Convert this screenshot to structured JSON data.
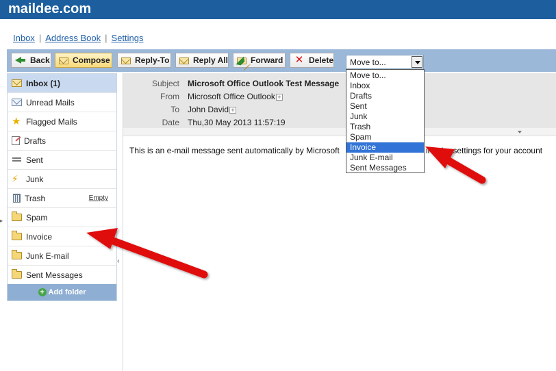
{
  "brand": "maildee.com",
  "nav": {
    "inbox": "Inbox",
    "address_book": "Address Book",
    "settings": "Settings",
    "separator": "|"
  },
  "toolbar": {
    "back": "Back",
    "compose": "Compose",
    "reply_to": "Reply-To",
    "reply_all": "Reply All",
    "forward": "Forward",
    "delete": "Delete"
  },
  "move_to": {
    "selected": "Move to...",
    "options": [
      "Move to...",
      "Inbox",
      "Drafts",
      "Sent",
      "Junk",
      "Trash",
      "Spam",
      "Invoice",
      "Junk E-mail",
      "Sent Messages"
    ],
    "highlighted": "Invoice"
  },
  "folders": [
    {
      "label": "Inbox (1)",
      "icon": "mail-open-icon"
    },
    {
      "label": "Unread Mails",
      "icon": "mail-icon"
    },
    {
      "label": "Flagged Mails",
      "icon": "star-icon"
    },
    {
      "label": "Drafts",
      "icon": "draft-icon"
    },
    {
      "label": "Sent",
      "icon": "sent-icon"
    },
    {
      "label": "Junk",
      "icon": "lightning-icon"
    },
    {
      "label": "Trash",
      "icon": "trash-icon",
      "action": "Empty"
    },
    {
      "label": "Spam",
      "icon": "folder-icon"
    },
    {
      "label": "Invoice",
      "icon": "folder-icon"
    },
    {
      "label": "Junk E-mail",
      "icon": "folder-icon"
    },
    {
      "label": "Sent Messages",
      "icon": "folder-icon"
    }
  ],
  "add_folder": "Add folder",
  "message": {
    "subject_label": "Subject",
    "subject": "Microsoft Office Outlook Test Message",
    "from_label": "From",
    "from": "Microsoft Office Outlook",
    "to_label": "To",
    "to": "John David",
    "date_label": "Date",
    "date": "Thu,30 May 2013 11:57:19",
    "body_start": "This is an e-mail message sent automatically by Microsoft",
    "body_end": "ing the settings for your account"
  },
  "colors": {
    "brand_bar": "#1d5f9e",
    "toolbar": "#9cb8d9",
    "selection": "#3173d6",
    "arrow": "#e01010"
  }
}
